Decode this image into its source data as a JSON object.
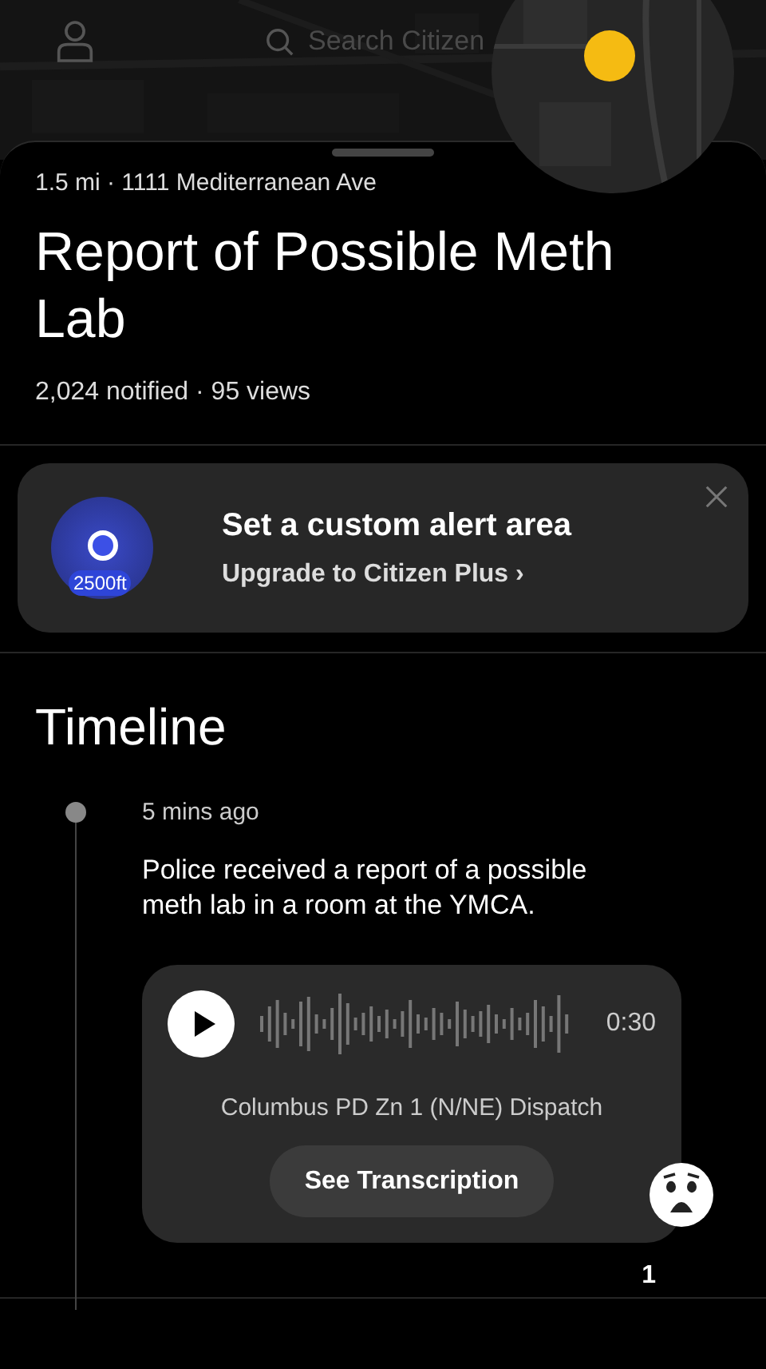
{
  "search": {
    "placeholder": "Search Citizen"
  },
  "incident": {
    "location": "1.5 mi · 1111 Mediterranean Ave",
    "title": "Report of Possible Meth Lab",
    "stats": "2,024 notified · 95 views"
  },
  "promo": {
    "radius": "2500ft",
    "title": "Set a custom alert area",
    "link": "Upgrade to Citizen Plus ›"
  },
  "timeline": {
    "heading": "Timeline",
    "entries": [
      {
        "time": "5 mins ago",
        "text": "Police received a report of a possible meth lab in a room at the YMCA.",
        "audio": {
          "duration": "0:30",
          "source": "Columbus PD Zn 1 (N/NE) Dispatch",
          "button": "See Transcription"
        },
        "reaction_count": "1"
      }
    ]
  }
}
